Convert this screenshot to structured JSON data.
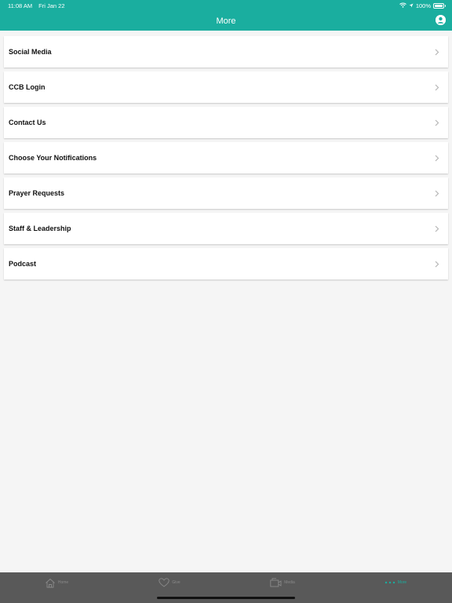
{
  "status_bar": {
    "time": "11:08 AM",
    "date": "Fri Jan 22",
    "battery": "100%"
  },
  "nav": {
    "title": "More"
  },
  "menu_items": [
    {
      "label": "Social Media"
    },
    {
      "label": "CCB Login"
    },
    {
      "label": "Contact Us"
    },
    {
      "label": "Choose Your Notifications"
    },
    {
      "label": "Prayer Requests"
    },
    {
      "label": "Staff & Leadership"
    },
    {
      "label": "Podcast"
    }
  ],
  "tabs": [
    {
      "label": "Home",
      "icon": "home-icon"
    },
    {
      "label": "Give",
      "icon": "heart-icon"
    },
    {
      "label": "Media",
      "icon": "media-icon"
    },
    {
      "label": "More",
      "icon": "more-icon",
      "active": true
    }
  ],
  "colors": {
    "accent": "#1aae9f",
    "tab_bar": "#595959",
    "background": "#f5f5f5"
  }
}
